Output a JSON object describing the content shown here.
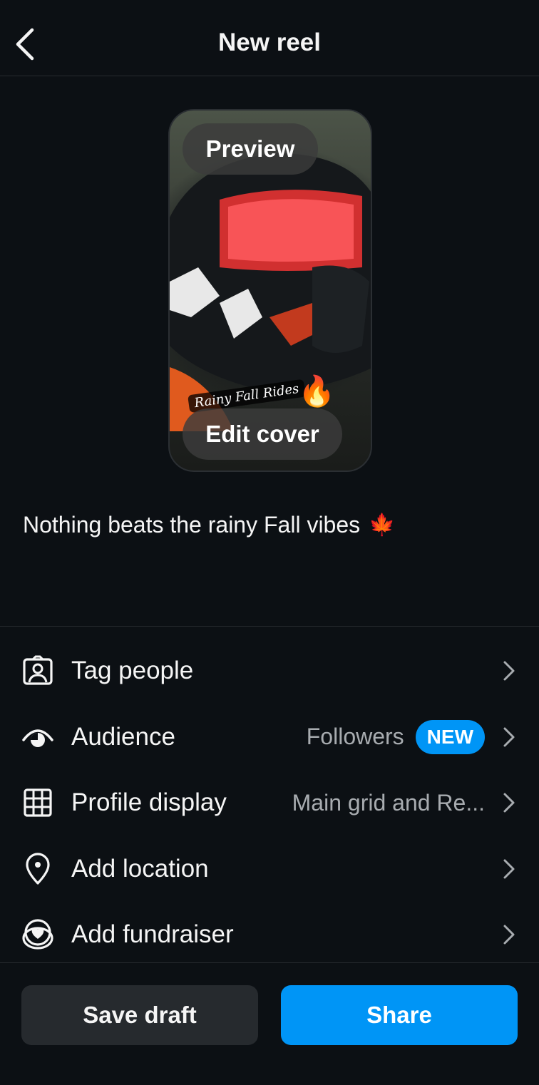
{
  "header": {
    "title": "New reel",
    "back_icon": "chevron-left-icon"
  },
  "preview": {
    "preview_label": "Preview",
    "edit_cover_label": "Edit cover",
    "overlay_text": "Rainy Fall Rides",
    "overlay_emoji": "🔥"
  },
  "caption": {
    "text": "Nothing beats the rainy Fall vibes",
    "emoji": "🍁"
  },
  "menu": {
    "items": [
      {
        "label": "Tag people",
        "icon": "tag-person-icon",
        "value": ""
      },
      {
        "label": "Audience",
        "icon": "eye-icon",
        "value": "Followers",
        "badge": "NEW"
      },
      {
        "label": "Profile display",
        "icon": "grid-icon",
        "value": "Main grid and Re..."
      },
      {
        "label": "Add location",
        "icon": "location-pin-icon",
        "value": ""
      },
      {
        "label": "Add fundraiser",
        "icon": "fundraiser-heart-icon",
        "value": ""
      }
    ]
  },
  "actions": {
    "save_draft": "Save draft",
    "share": "Share"
  },
  "colors": {
    "background": "#0c1014",
    "accent": "#0095f6",
    "secondary_button": "#262a2e",
    "muted_text": "#a8acb0"
  }
}
